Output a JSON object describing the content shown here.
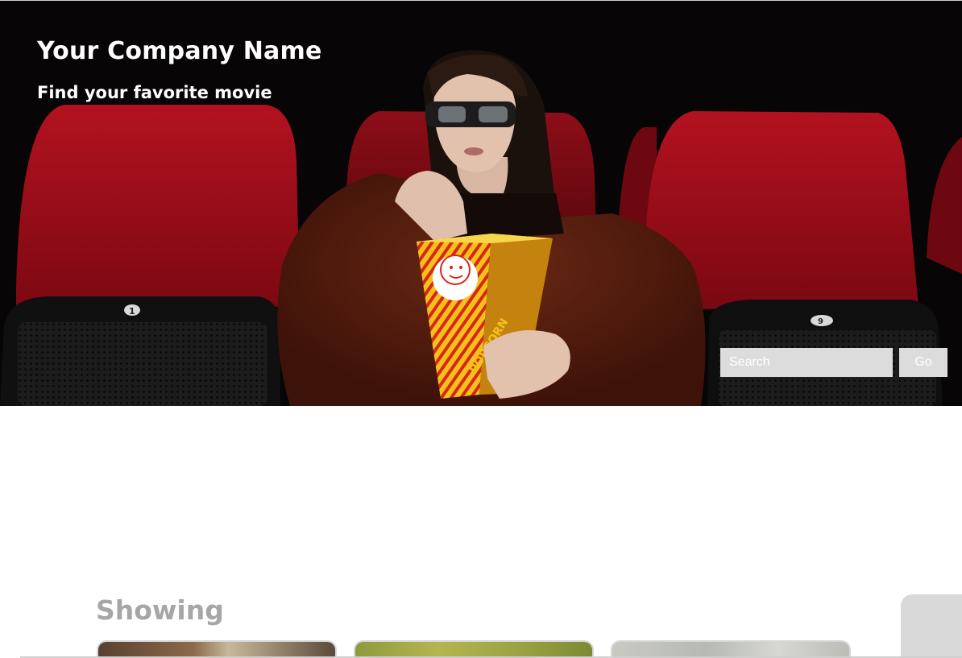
{
  "header": {
    "company_name": "Your Company Name",
    "tagline": "Find your favorite movie"
  },
  "hero": {
    "image": "cinema-woman-eating-popcorn",
    "seat_numbers": [
      "1",
      "9"
    ],
    "popcorn_label": "POPCORN"
  },
  "search": {
    "placeholder": "Search",
    "value": "",
    "button_label": "Go"
  },
  "showing": {
    "heading": "Showing",
    "cards": [
      {
        "thumbnail": "movie-poster-1"
      },
      {
        "thumbnail": "movie-poster-2"
      },
      {
        "thumbnail": "movie-poster-3"
      }
    ]
  },
  "colors": {
    "hero_bg": "#070506",
    "seat_red": "#a50b1a",
    "input_bg": "#dcdcdc",
    "heading_gray": "#a6a6a6"
  }
}
